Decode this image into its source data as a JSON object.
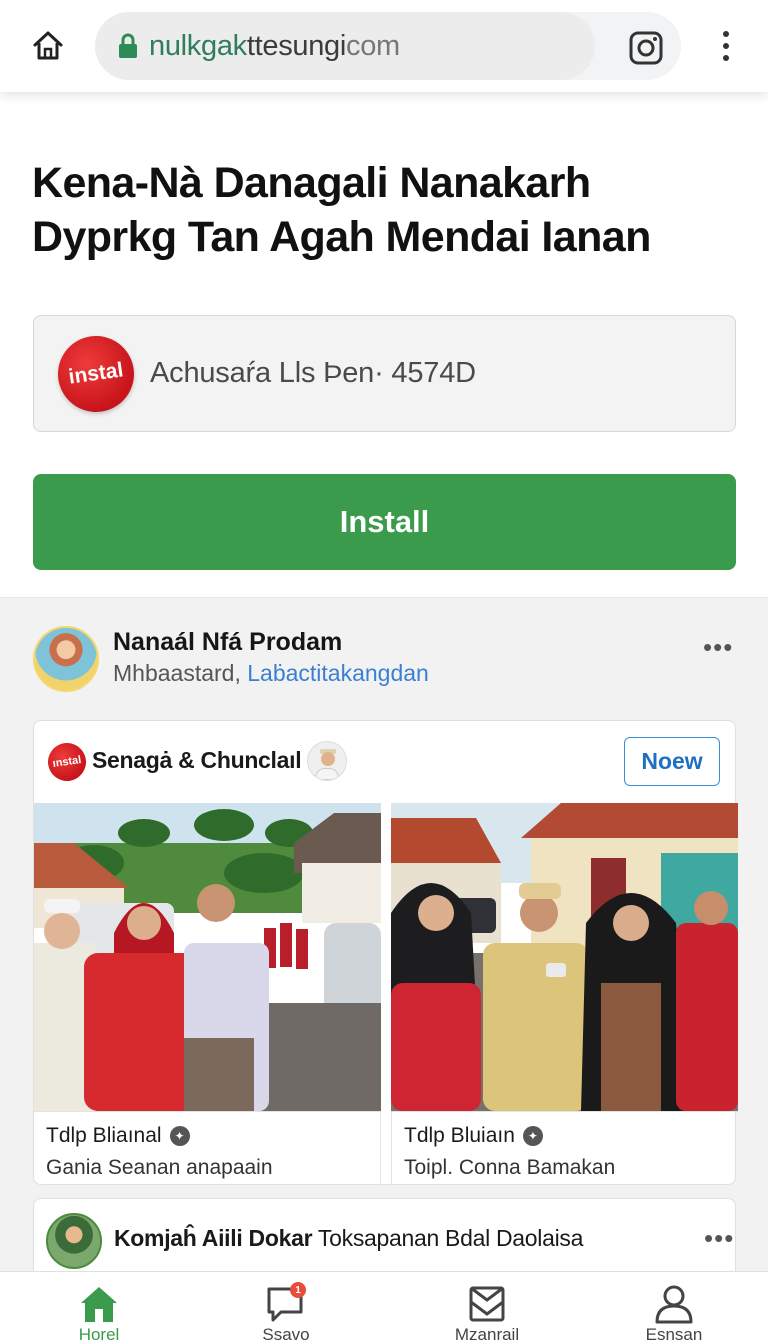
{
  "browser": {
    "url_prefix": "nulkgak",
    "url_main": "ttesungi",
    "url_suffix": "com",
    "icons": [
      "home-icon",
      "lock-icon",
      "instagram-icon",
      "more-vertical-icon"
    ]
  },
  "headline": {
    "line1": "Kena-Nà Danagali Nanakarh",
    "line2": "Dyprkg Tan Agah Mendai Ianan"
  },
  "app": {
    "logo_text": "instal",
    "meta": "Achusaŕa Lls Þen· 4574D",
    "install_label": "Install"
  },
  "post": {
    "author": "Nanaál Nfá Prodam",
    "sub_plain": "Mhbaastard,",
    "sub_link": "Laḃactitakangdan",
    "more": "•••"
  },
  "shared": {
    "logo_text": "ınstal",
    "title": "Senagȧ & Chunclaıl",
    "button_label": "Noew",
    "items": [
      {
        "title": "Tdlp Bliaınal",
        "subtitle": "Gania Seanan anapaain"
      },
      {
        "title": "Tdlp Bluiaın",
        "subtitle": "Toipl. Conna Bamakan"
      }
    ]
  },
  "second_post": {
    "author": "Komjaĥ Aiili Dokar",
    "text": "Toksapanan Bdal Daolaisa",
    "more": "•••"
  },
  "nav": {
    "items": [
      {
        "label": "Horel",
        "icon": "home-icon"
      },
      {
        "label": "Ssavo",
        "icon": "chat-icon"
      },
      {
        "label": "Mzanrail",
        "icon": "inbox-icon"
      },
      {
        "label": "Esnsan",
        "icon": "profile-icon"
      }
    ],
    "badge": "1"
  },
  "colors": {
    "accent_green": "#3b9b4c",
    "link_blue": "#3b7fd1",
    "brand_red": "#d11d22"
  }
}
